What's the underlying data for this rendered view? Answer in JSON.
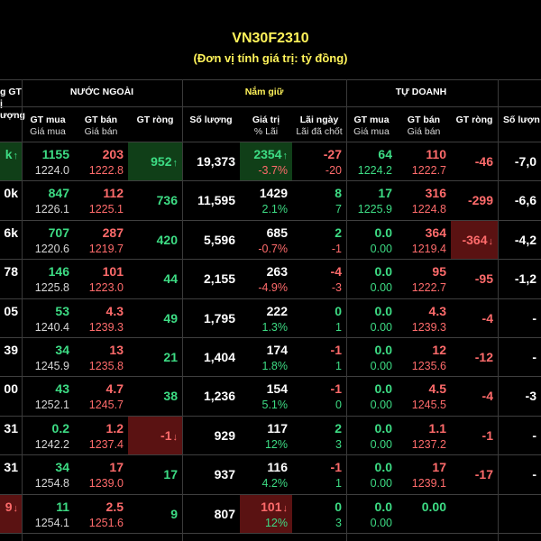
{
  "header": {
    "title": "VN30F2310",
    "subtitle": "(Đơn vị tính giá trị: tỷ đồng)"
  },
  "columns": {
    "left_partial_lines": [
      "g GT",
      "ị",
      "ượng"
    ],
    "nuoc_ngoai": "NƯỚC NGOÀI",
    "nam_giu": "Nắm giữ",
    "tu_doanh": "TỰ DOANH",
    "gt_mua": "GT mua",
    "gia_mua": "Giá mua",
    "gt_ban": "GT bán",
    "gia_ban": "Giá bán",
    "gt_rong": "GT ròng",
    "so_luong": "Số lượng",
    "gia_tri": "Giá trị",
    "pct_lai": "% Lãi",
    "lai_ngay": "Lãi ngày",
    "lai_da_chot": "Lãi đã chốt",
    "so_luong_partial": "Số lượn"
  },
  "colors": {
    "green": "#3ddc84",
    "red": "#ff6b6b",
    "header_yellow": "#fff35a",
    "green_highlight": "#103f18",
    "red_highlight": "#5a1212"
  },
  "rows": [
    {
      "lp": "k",
      "lp_hl": "green",
      "lp_arrow": "↑",
      "nn_mua": "1155",
      "nn_gia_mua": "1224.0",
      "nn_ban": "203",
      "nn_gia_ban": "1222.8",
      "nn_rong": "952",
      "nn_rong_hl": "green",
      "nn_rong_arrow": "↑",
      "sl": "19,373",
      "gt": "2354",
      "gt_hl": "green",
      "gt_arrow": "↑",
      "pct": "-3.7%",
      "ln": "-27",
      "ldc": "-20",
      "td_mua": "64",
      "td_gia_mua": "1224.2",
      "td_ban": "110",
      "td_gia_ban": "1222.7",
      "td_rong": "-46",
      "td_sl": "-7,0"
    },
    {
      "lp": "0k",
      "nn_mua": "847",
      "nn_gia_mua": "1226.1",
      "nn_ban": "112",
      "nn_gia_ban": "1225.1",
      "nn_rong": "736",
      "sl": "11,595",
      "gt": "1429",
      "pct": "2.1%",
      "ln": "8",
      "ldc": "7",
      "td_mua": "17",
      "td_gia_mua": "1225.9",
      "td_ban": "316",
      "td_gia_ban": "1224.8",
      "td_rong": "-299",
      "td_sl": "-6,6"
    },
    {
      "lp": "6k",
      "nn_mua": "707",
      "nn_gia_mua": "1220.6",
      "nn_ban": "287",
      "nn_gia_ban": "1219.7",
      "nn_rong": "420",
      "sl": "5,596",
      "gt": "685",
      "pct": "-0.7%",
      "ln": "2",
      "ldc": "-1",
      "td_mua": "0.0",
      "td_gia_mua": "0.00",
      "td_ban": "364",
      "td_gia_ban": "1219.4",
      "td_rong": "-364",
      "td_rong_hl": "red",
      "td_rong_arrow": "↓",
      "td_sl": "-4,2"
    },
    {
      "lp": "78",
      "nn_mua": "146",
      "nn_gia_mua": "1225.8",
      "nn_ban": "101",
      "nn_gia_ban": "1223.0",
      "nn_rong": "44",
      "sl": "2,155",
      "gt": "263",
      "pct": "-4.9%",
      "ln": "-4",
      "ldc": "-3",
      "td_mua": "0.0",
      "td_gia_mua": "0.00",
      "td_ban": "95",
      "td_gia_ban": "1222.7",
      "td_rong": "-95",
      "td_sl": "-1,2"
    },
    {
      "lp": "05",
      "nn_mua": "53",
      "nn_gia_mua": "1240.4",
      "nn_ban": "4.3",
      "nn_gia_ban": "1239.3",
      "nn_rong": "49",
      "sl": "1,795",
      "gt": "222",
      "pct": "1.3%",
      "ln": "0",
      "ldc": "1",
      "td_mua": "0.0",
      "td_gia_mua": "0.00",
      "td_ban": "4.3",
      "td_gia_ban": "1239.3",
      "td_rong": "-4",
      "td_sl": "-"
    },
    {
      "lp": "39",
      "nn_mua": "34",
      "nn_gia_mua": "1245.9",
      "nn_ban": "13",
      "nn_gia_ban": "1235.8",
      "nn_rong": "21",
      "sl": "1,404",
      "gt": "174",
      "pct": "1.8%",
      "ln": "-1",
      "ldc": "1",
      "td_mua": "0.0",
      "td_gia_mua": "0.00",
      "td_ban": "12",
      "td_gia_ban": "1235.6",
      "td_rong": "-12",
      "td_sl": "-"
    },
    {
      "lp": "00",
      "nn_mua": "43",
      "nn_gia_mua": "1252.1",
      "nn_ban": "4.7",
      "nn_gia_ban": "1245.7",
      "nn_rong": "38",
      "sl": "1,236",
      "gt": "154",
      "pct": "5.1%",
      "ln": "-1",
      "ldc": "0",
      "td_mua": "0.0",
      "td_gia_mua": "0.00",
      "td_ban": "4.5",
      "td_gia_ban": "1245.5",
      "td_rong": "-4",
      "td_sl": "-3"
    },
    {
      "lp": "31",
      "nn_mua": "0.2",
      "nn_gia_mua": "1242.2",
      "nn_ban": "1.2",
      "nn_gia_ban": "1237.4",
      "nn_rong": "-1",
      "nn_rong_hl": "red",
      "nn_rong_arrow": "↓",
      "sl": "929",
      "gt": "117",
      "pct": "12%",
      "ln": "2",
      "ldc": "3",
      "td_mua": "0.0",
      "td_gia_mua": "0.00",
      "td_ban": "1.1",
      "td_gia_ban": "1237.2",
      "td_rong": "-1",
      "td_sl": "-"
    },
    {
      "lp": "31",
      "nn_mua": "34",
      "nn_gia_mua": "1254.8",
      "nn_ban": "17",
      "nn_gia_ban": "1239.0",
      "nn_rong": "17",
      "sl": "937",
      "gt": "116",
      "pct": "4.2%",
      "ln": "-1",
      "ldc": "1",
      "td_mua": "0.0",
      "td_gia_mua": "0.00",
      "td_ban": "17",
      "td_gia_ban": "1239.1",
      "td_rong": "-17",
      "td_sl": "-"
    },
    {
      "lp": "9",
      "lp_hl": "red",
      "lp_arrow": "↓",
      "nn_mua": "11",
      "nn_gia_mua": "1254.1",
      "nn_ban": "2.5",
      "nn_gia_ban": "1251.6",
      "nn_rong": "9",
      "sl": "807",
      "gt": "101",
      "gt_hl": "red",
      "gt_arrow": "↓",
      "pct": "12%",
      "ln": "0",
      "ldc": "3",
      "td_mua": "0.0",
      "td_gia_mua": "0.00",
      "td_ban": "0.00",
      "td_gia_ban": "",
      "td_rong": "",
      "td_sl": ""
    }
  ]
}
